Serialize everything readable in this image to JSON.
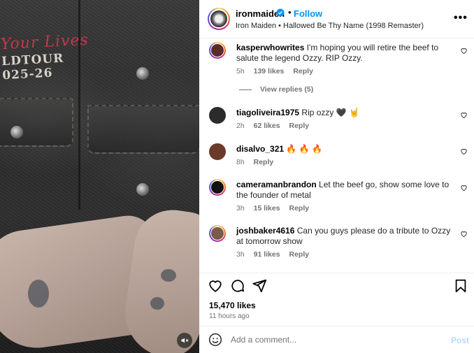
{
  "post": {
    "username": "ironmaiden",
    "follow_label": "Follow",
    "dot": "•",
    "subtitle": "Iron Maiden • Hallowed Be Thy Name (1998 Remaster)",
    "more": "•••"
  },
  "media": {
    "embroidery": [
      "Your Lives",
      "LDTOUR",
      "025-26"
    ],
    "mute_icon": "speaker-muted-icon"
  },
  "comments": [
    {
      "username": "kasperwhowrites",
      "text": "I'm hoping you will retire the beef to salute the legend Ozzy. RIP Ozzy.",
      "time": "5h",
      "likes": "139 likes",
      "reply": "Reply",
      "view_replies": "View replies (5)",
      "avatar_color": "#5a2a2a"
    },
    {
      "username": "tiagoliveira1975",
      "text": "Rip ozzy 🖤 🤘",
      "time": "2h",
      "likes": "62 likes",
      "reply": "Reply",
      "avatar_color": "#2b2b2b"
    },
    {
      "username": "disalvo_321",
      "text": "🔥 🔥 🔥",
      "time": "8h",
      "reply": "Reply",
      "avatar_color": "#6b3a2a"
    },
    {
      "username": "cameramanbrandon",
      "text": "Let the beef go, show some love to the founder of metal",
      "time": "3h",
      "likes": "15 likes",
      "reply": "Reply",
      "avatar_color": "#111111"
    },
    {
      "username": "joshbaker4616",
      "text": "Can you guys please do a tribute to Ozzy at tomorrow show",
      "time": "3h",
      "likes": "91 likes",
      "reply": "Reply",
      "avatar_color": "#7a5a48"
    }
  ],
  "actions": {
    "likes": "15,470 likes",
    "time": "11 hours ago"
  },
  "composer": {
    "placeholder": "Add a comment...",
    "post_label": "Post"
  },
  "colors": {
    "accent": "#0095f6",
    "muted": "#737373",
    "post_disabled": "#b3dbff"
  }
}
